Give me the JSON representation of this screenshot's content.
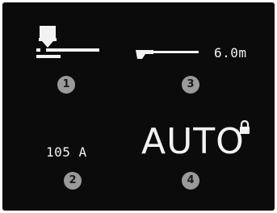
{
  "panel": {
    "cable_length": "6.0m",
    "current": "105 A",
    "mode": "AUTO"
  },
  "callouts": {
    "c1": "1",
    "c2": "2",
    "c3": "3",
    "c4": "4"
  },
  "icons": {
    "torch": "welding-torch-icon",
    "cable": "cable-length-icon",
    "lock": "lock-icon"
  },
  "colors": {
    "screen_bg": "#0b0b0b",
    "lcd_fg": "#f2f2f2",
    "callout_bg": "#9a9a9a"
  }
}
